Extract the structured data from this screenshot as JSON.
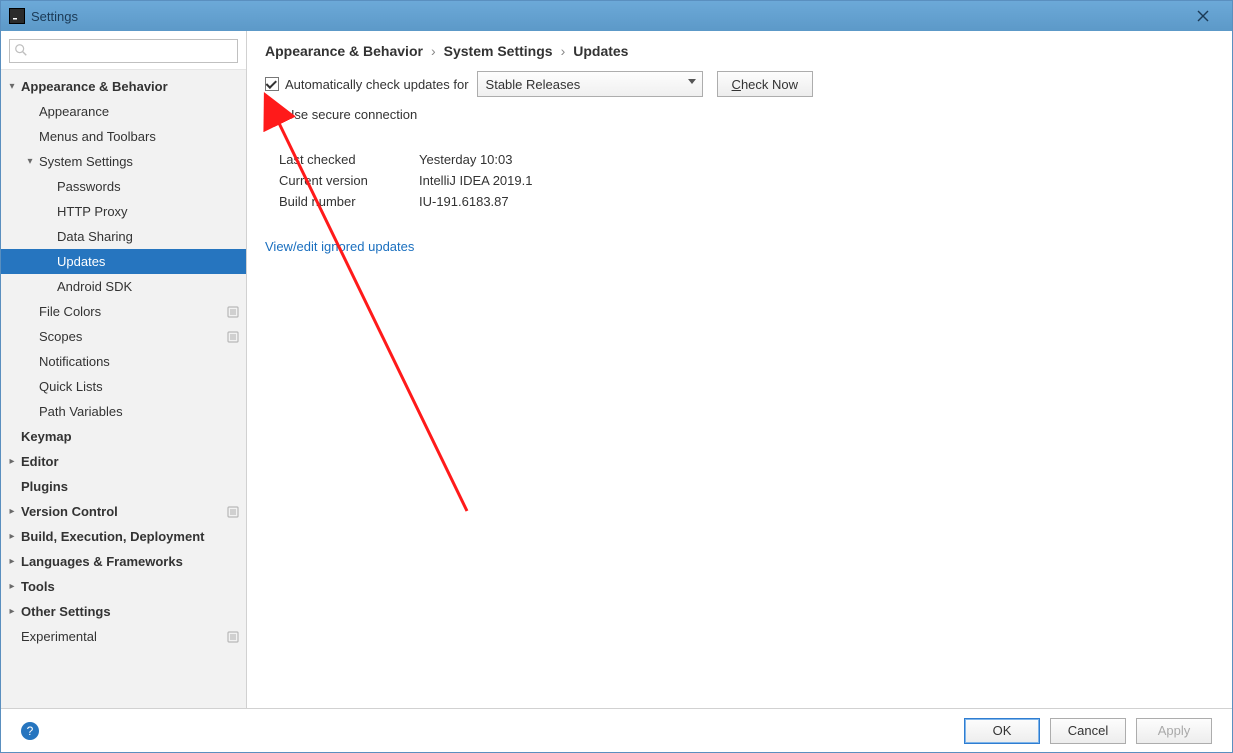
{
  "window": {
    "title": "Settings"
  },
  "search": {
    "placeholder": ""
  },
  "tree": {
    "items": [
      {
        "label": "Appearance & Behavior",
        "level": 0,
        "bold": true,
        "expander": "v"
      },
      {
        "label": "Appearance",
        "level": 1
      },
      {
        "label": "Menus and Toolbars",
        "level": 1
      },
      {
        "label": "System Settings",
        "level": 1,
        "expander": "v"
      },
      {
        "label": "Passwords",
        "level": 2
      },
      {
        "label": "HTTP Proxy",
        "level": 2
      },
      {
        "label": "Data Sharing",
        "level": 2
      },
      {
        "label": "Updates",
        "level": 2,
        "selected": true
      },
      {
        "label": "Android SDK",
        "level": 2
      },
      {
        "label": "File Colors",
        "level": 1,
        "badge": true
      },
      {
        "label": "Scopes",
        "level": 1,
        "badge": true
      },
      {
        "label": "Notifications",
        "level": 1
      },
      {
        "label": "Quick Lists",
        "level": 1
      },
      {
        "label": "Path Variables",
        "level": 1
      },
      {
        "label": "Keymap",
        "level": 0,
        "bold": true
      },
      {
        "label": "Editor",
        "level": 0,
        "bold": true,
        "expander": ">"
      },
      {
        "label": "Plugins",
        "level": 0,
        "bold": true
      },
      {
        "label": "Version Control",
        "level": 0,
        "bold": true,
        "expander": ">",
        "badge": true
      },
      {
        "label": "Build, Execution, Deployment",
        "level": 0,
        "bold": true,
        "expander": ">"
      },
      {
        "label": "Languages & Frameworks",
        "level": 0,
        "bold": true,
        "expander": ">"
      },
      {
        "label": "Tools",
        "level": 0,
        "bold": true,
        "expander": ">"
      },
      {
        "label": "Other Settings",
        "level": 0,
        "bold": true,
        "expander": ">"
      },
      {
        "label": "Experimental",
        "level": 0,
        "badge": true
      }
    ]
  },
  "breadcrumb": {
    "a": "Appearance & Behavior",
    "b": "System Settings",
    "c": "Updates"
  },
  "main": {
    "auto_check_label": "Automatically check updates for",
    "auto_check_checked": true,
    "channel_selected": "Stable Releases",
    "check_now_label": "Check Now",
    "use_secure_label": "Use secure connection",
    "use_secure_checked": false,
    "info": {
      "last_checked_k": "Last checked",
      "last_checked_v": "Yesterday 10:03",
      "current_version_k": "Current version",
      "current_version_v": "IntelliJ IDEA 2019.1",
      "build_number_k": "Build number",
      "build_number_v": "IU-191.6183.87"
    },
    "ignored_link": "View/edit ignored updates"
  },
  "footer": {
    "ok": "OK",
    "cancel": "Cancel",
    "apply": "Apply"
  }
}
